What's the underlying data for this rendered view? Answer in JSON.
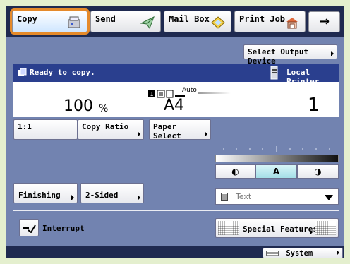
{
  "tabs": [
    {
      "label": "Copy",
      "icon": "copier-icon"
    },
    {
      "label": "Send",
      "icon": "paper-plane-icon"
    },
    {
      "label": "Mail Box",
      "icon": "mailbox-icon"
    },
    {
      "label": "Print Job",
      "icon": "printer-icon"
    }
  ],
  "arrow_label": "→",
  "select_output_label": "Select Output Device",
  "status": {
    "message": "Ready to copy.",
    "device": "Local Printer"
  },
  "info": {
    "ratio_value": "100",
    "ratio_unit": "%",
    "paper_auto": "Auto",
    "paper_size": "A4",
    "copies": "1"
  },
  "buttons": {
    "one_to_one": "1:1",
    "copy_ratio": "Copy Ratio",
    "paper_select": "Paper Select",
    "finishing": "Finishing",
    "two_sided": "2-Sided",
    "interrupt": "Interrupt",
    "special_features": "Special Features",
    "system_monitor": "System Monitor"
  },
  "density": {
    "light": "◐",
    "auto": "A",
    "dark": "◑"
  },
  "image_type": {
    "label": "Text"
  },
  "colors": {
    "frame": "#7283b0",
    "topbar": "#1f2a50",
    "active_outline": "#e58a2b",
    "status_bar": "#2a3f8e",
    "background": "#e4efce"
  }
}
